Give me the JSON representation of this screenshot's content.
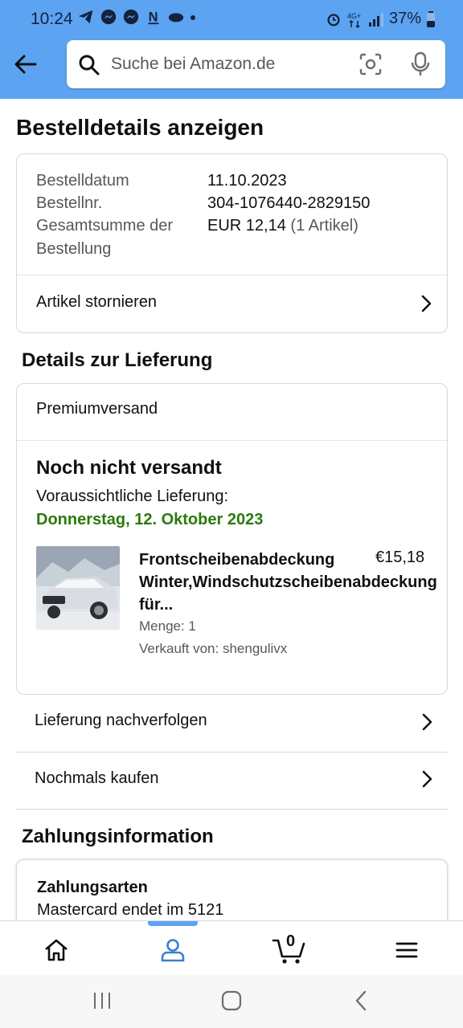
{
  "status": {
    "time": "10:24",
    "battery": "37%",
    "network": "4G+"
  },
  "search": {
    "placeholder": "Suche bei Amazon.de"
  },
  "page": {
    "title": "Bestelldetails anzeigen"
  },
  "order": {
    "date_label": "Bestelldatum",
    "date_value": "11.10.2023",
    "number_label": "Bestellnr.",
    "number_value": "304-1076440-2829150",
    "total_label_line1": "Gesamtsumme der",
    "total_label_line2": "Bestellung",
    "total_value": "EUR 12,14",
    "total_items": "(1 Artikel)",
    "cancel_label": "Artikel stornieren"
  },
  "delivery": {
    "heading": "Details zur Lieferung",
    "shipping_type": "Premiumversand",
    "status": "Noch nicht versandt",
    "eta_label": "Voraussichtliche Lieferung:",
    "eta_date": "Donnerstag, 12. Oktober 2023",
    "item": {
      "title_line1": "Frontscheibenabdeckung",
      "title_line2": "Winter,Windschutzscheibenabdeckung",
      "title_line3": "für...",
      "price": "€15,18",
      "quantity": "Menge: 1",
      "seller": "Verkauft von: shengulivx"
    },
    "track_label": "Lieferung nachverfolgen",
    "buy_again_label": "Nochmals kaufen"
  },
  "payment": {
    "heading": "Zahlungsinformation",
    "methods_label": "Zahlungsarten",
    "card": "Mastercard",
    "card_suffix": "endet im 5121"
  },
  "bottom_nav": {
    "cart_count": "0"
  },
  "colors": {
    "header_bg": "#5ca3f2",
    "eta_green": "#2b7a0b"
  }
}
